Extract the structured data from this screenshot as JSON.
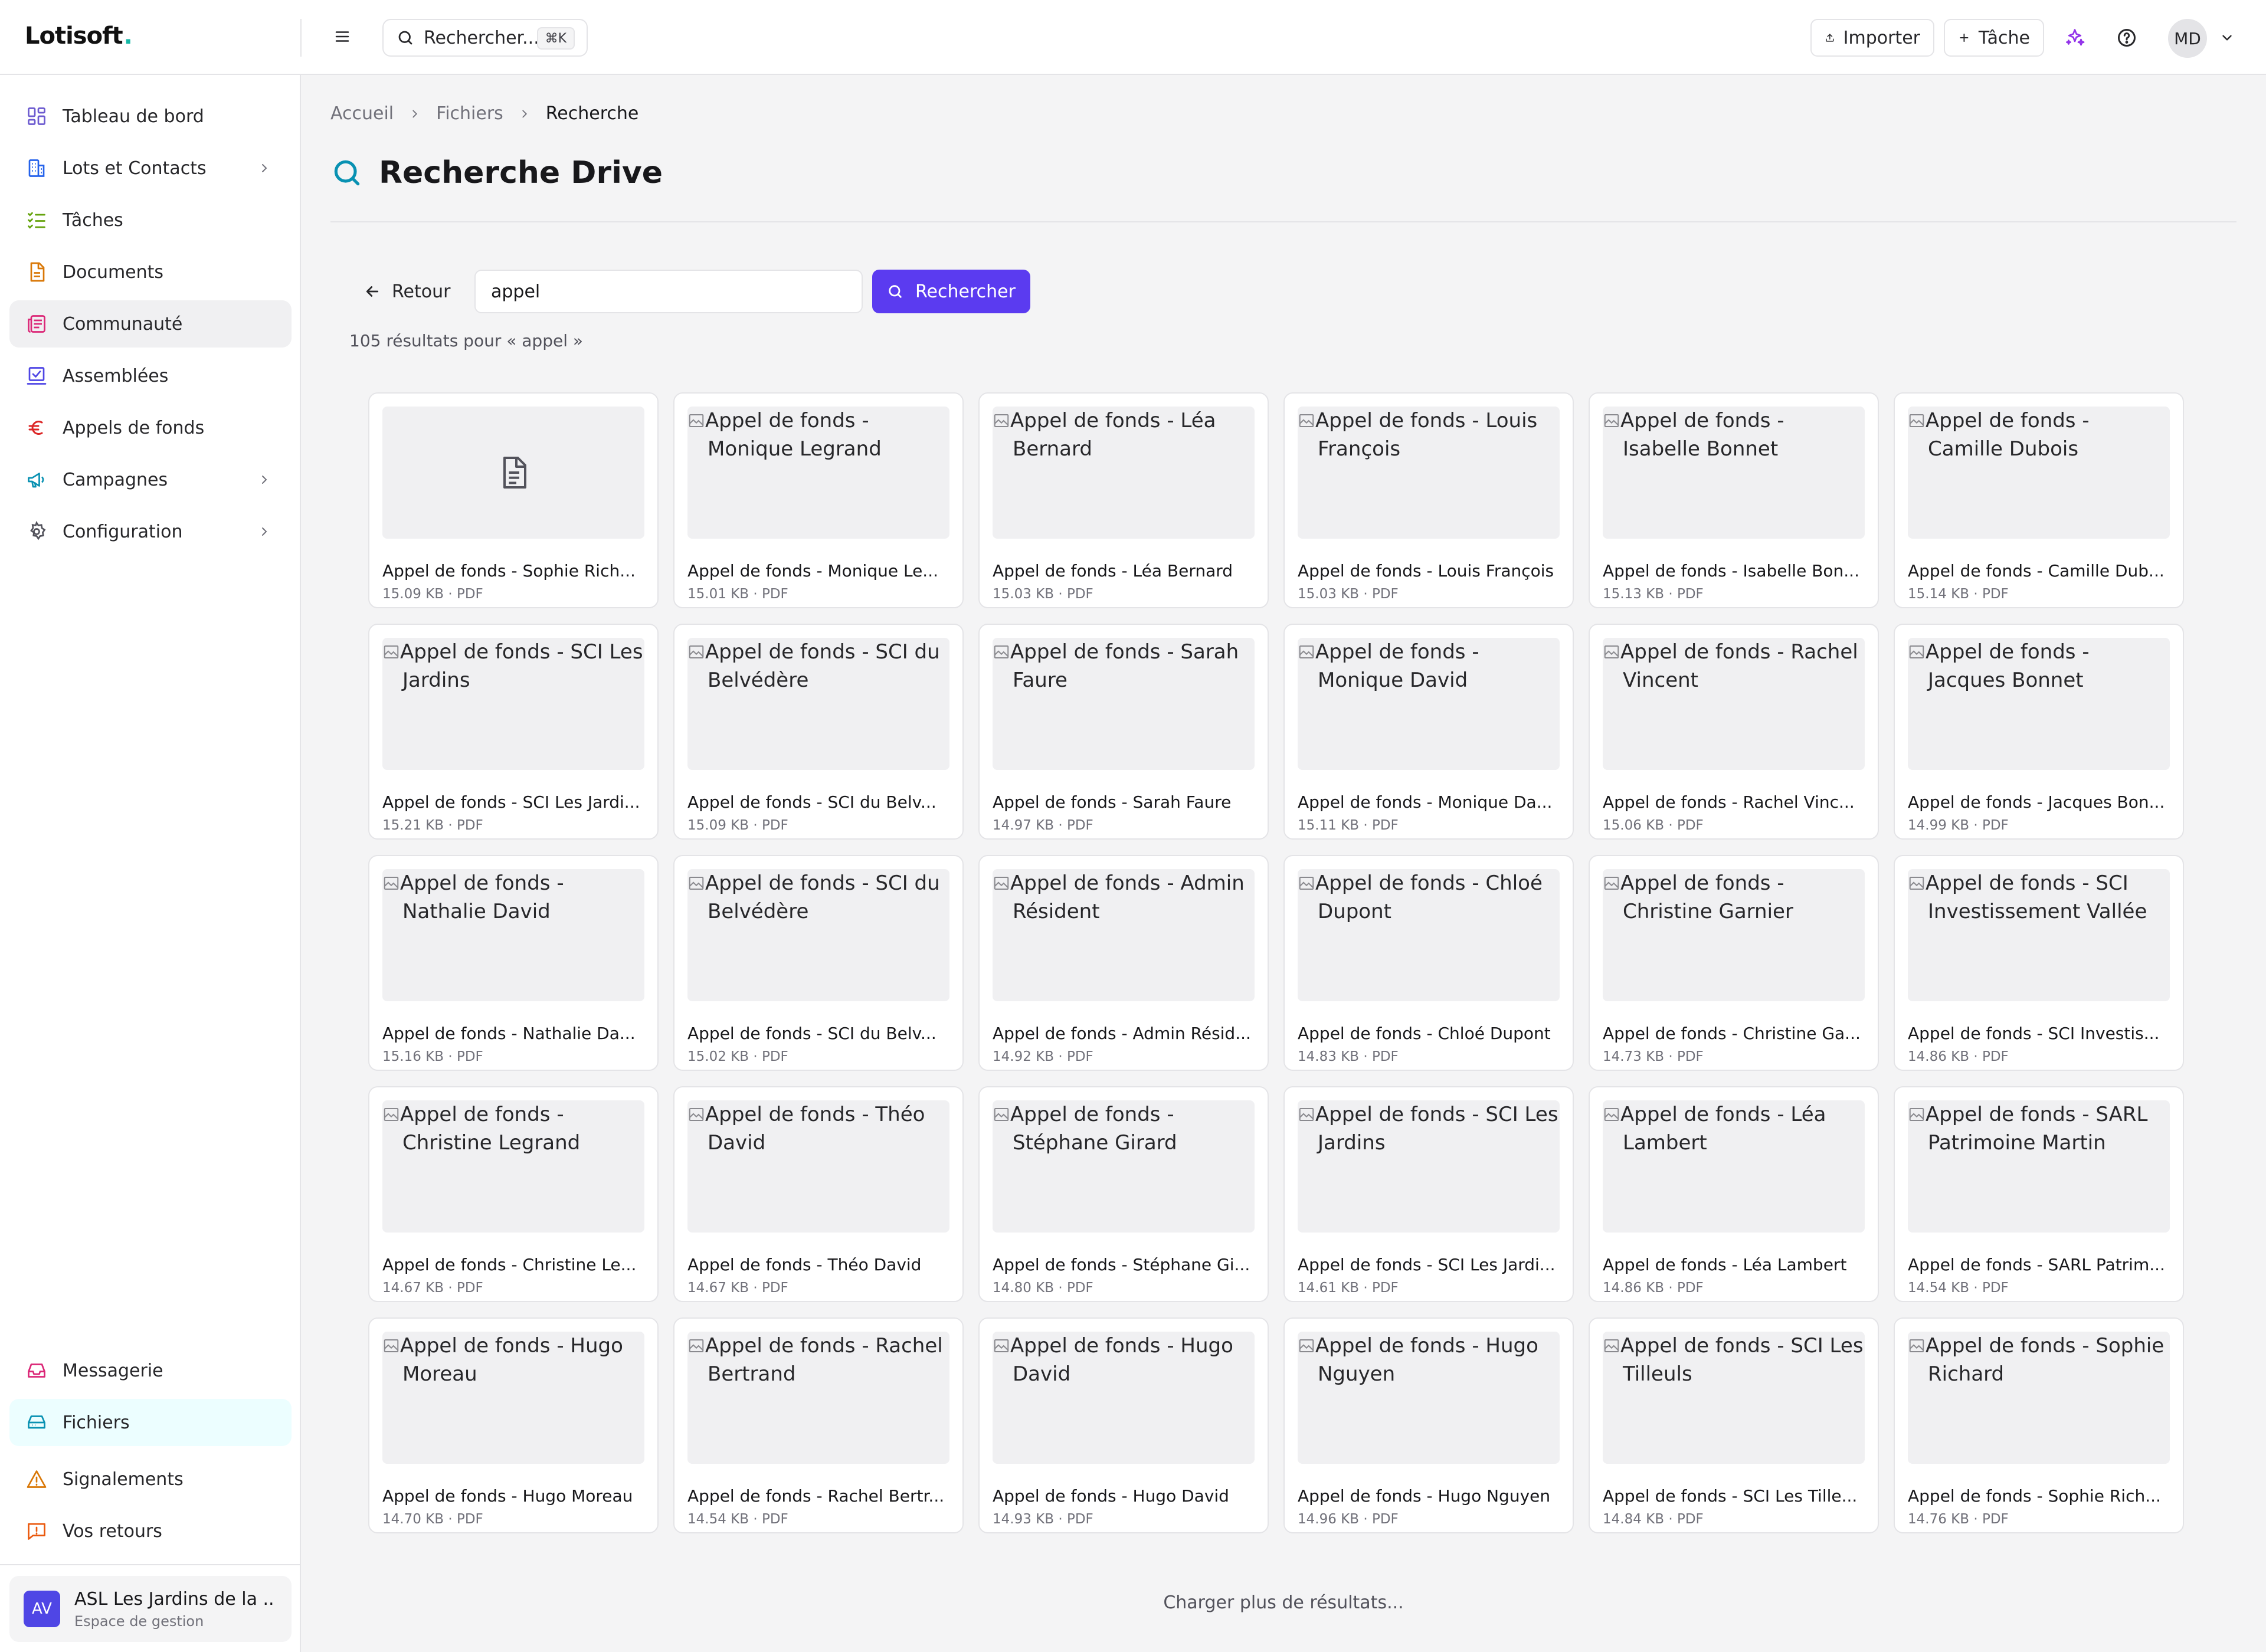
{
  "app": {
    "logo_text": "Lotisoft",
    "logo_dot": ".",
    "accent": "#5b3bf0"
  },
  "topbar": {
    "search_placeholder": "Rechercher...",
    "search_shortcut": "⌘K",
    "import_label": "Importer",
    "task_label": "Tâche",
    "avatar_initials": "MD"
  },
  "sidebar": {
    "items": [
      {
        "label": "Tableau de bord",
        "icon": "dashboard-icon",
        "color": "#6d5bd0"
      },
      {
        "label": "Lots et Contacts",
        "icon": "building-icon",
        "color": "#2563eb",
        "expandable": true
      },
      {
        "label": "Tâches",
        "icon": "checklist-icon",
        "color": "#65a30d"
      },
      {
        "label": "Documents",
        "icon": "document-icon",
        "color": "#d97706"
      },
      {
        "label": "Communauté",
        "icon": "newspaper-icon",
        "color": "#db2777",
        "active": true
      },
      {
        "label": "Assemblées",
        "icon": "vote-icon",
        "color": "#4f46e5"
      },
      {
        "label": "Appels de fonds",
        "icon": "euro-icon",
        "color": "#dc2626"
      },
      {
        "label": "Campagnes",
        "icon": "megaphone-icon",
        "color": "#0891b2",
        "expandable": true
      },
      {
        "label": "Configuration",
        "icon": "gear-icon",
        "color": "#52525b",
        "expandable": true
      }
    ],
    "bottom_items": [
      {
        "label": "Messagerie",
        "icon": "inbox-icon",
        "color": "#db2777"
      },
      {
        "label": "Fichiers",
        "icon": "drive-icon",
        "color": "#0891b2",
        "active": true
      },
      {
        "label": "Signalements",
        "icon": "warning-icon",
        "color": "#d97706"
      },
      {
        "label": "Vos retours",
        "icon": "feedback-icon",
        "color": "#ea580c"
      }
    ],
    "org": {
      "initials": "AV",
      "name": "ASL Les Jardins de la ...",
      "subtitle": "Espace de gestion"
    }
  },
  "breadcrumb": {
    "home": "Accueil",
    "files": "Fichiers",
    "current": "Recherche"
  },
  "page": {
    "title": "Recherche Drive"
  },
  "search": {
    "back_label": "Retour",
    "query": "appel",
    "button_label": "Rechercher",
    "results_text": "105 résultats pour « appel »"
  },
  "results": [
    {
      "alt": "",
      "name": "Appel de fonds - Sophie Rich...",
      "meta": "15.09 KB · PDF",
      "placeholder": true
    },
    {
      "alt": "Appel de fonds - Monique Legrand",
      "name": "Appel de fonds - Monique Le...",
      "meta": "15.01 KB · PDF"
    },
    {
      "alt": "Appel de fonds - Léa Bernard",
      "name": "Appel de fonds - Léa Bernard",
      "meta": "15.03 KB · PDF"
    },
    {
      "alt": "Appel de fonds - Louis François",
      "name": "Appel de fonds - Louis François",
      "meta": "15.03 KB · PDF"
    },
    {
      "alt": "Appel de fonds - Isabelle Bonnet",
      "name": "Appel de fonds - Isabelle Bon...",
      "meta": "15.13 KB · PDF"
    },
    {
      "alt": "Appel de fonds - Camille Dubois",
      "name": "Appel de fonds - Camille Dub...",
      "meta": "15.14 KB · PDF"
    },
    {
      "alt": "Appel de fonds - SCI Les Jardins",
      "name": "Appel de fonds - SCI Les Jardi...",
      "meta": "15.21 KB · PDF"
    },
    {
      "alt": "Appel de fonds - SCI du Belvédère",
      "name": "Appel de fonds - SCI du Belv...",
      "meta": "15.09 KB · PDF"
    },
    {
      "alt": "Appel de fonds - Sarah Faure",
      "name": "Appel de fonds - Sarah Faure",
      "meta": "14.97 KB · PDF"
    },
    {
      "alt": "Appel de fonds - Monique David",
      "name": "Appel de fonds - Monique Da...",
      "meta": "15.11 KB · PDF"
    },
    {
      "alt": "Appel de fonds - Rachel Vincent",
      "name": "Appel de fonds - Rachel Vinc...",
      "meta": "15.06 KB · PDF"
    },
    {
      "alt": "Appel de fonds - Jacques Bonnet",
      "name": "Appel de fonds - Jacques Bon...",
      "meta": "14.99 KB · PDF"
    },
    {
      "alt": "Appel de fonds - Nathalie David",
      "name": "Appel de fonds - Nathalie Da...",
      "meta": "15.16 KB · PDF"
    },
    {
      "alt": "Appel de fonds - SCI du Belvédère",
      "name": "Appel de fonds - SCI du Belv...",
      "meta": "15.02 KB · PDF"
    },
    {
      "alt": "Appel de fonds - Admin Résident",
      "name": "Appel de fonds - Admin Résid...",
      "meta": "14.92 KB · PDF"
    },
    {
      "alt": "Appel de fonds - Chloé Dupont",
      "name": "Appel de fonds - Chloé Dupont",
      "meta": "14.83 KB · PDF"
    },
    {
      "alt": "Appel de fonds - Christine Garnier",
      "name": "Appel de fonds - Christine Ga...",
      "meta": "14.73 KB · PDF"
    },
    {
      "alt": "Appel de fonds - SCI Investissement Vallée",
      "name": "Appel de fonds - SCI Investis...",
      "meta": "14.86 KB · PDF"
    },
    {
      "alt": "Appel de fonds - Christine Legrand",
      "name": "Appel de fonds - Christine Le...",
      "meta": "14.67 KB · PDF"
    },
    {
      "alt": "Appel de fonds - Théo David",
      "name": "Appel de fonds - Théo David",
      "meta": "14.67 KB · PDF"
    },
    {
      "alt": "Appel de fonds - Stéphane Girard",
      "name": "Appel de fonds - Stéphane Gi...",
      "meta": "14.80 KB · PDF"
    },
    {
      "alt": "Appel de fonds - SCI Les Jardins",
      "name": "Appel de fonds - SCI Les Jardi...",
      "meta": "14.61 KB · PDF"
    },
    {
      "alt": "Appel de fonds - Léa Lambert",
      "name": "Appel de fonds - Léa Lambert",
      "meta": "14.86 KB · PDF"
    },
    {
      "alt": "Appel de fonds - SARL Patrimoine Martin",
      "name": "Appel de fonds - SARL Patrim...",
      "meta": "14.54 KB · PDF"
    },
    {
      "alt": "Appel de fonds - Hugo Moreau",
      "name": "Appel de fonds - Hugo Moreau",
      "meta": "14.70 KB · PDF"
    },
    {
      "alt": "Appel de fonds - Rachel Bertrand",
      "name": "Appel de fonds - Rachel Bertr...",
      "meta": "14.54 KB · PDF"
    },
    {
      "alt": "Appel de fonds - Hugo David",
      "name": "Appel de fonds - Hugo David",
      "meta": "14.93 KB · PDF"
    },
    {
      "alt": "Appel de fonds - Hugo Nguyen",
      "name": "Appel de fonds - Hugo Nguyen",
      "meta": "14.96 KB · PDF"
    },
    {
      "alt": "Appel de fonds - SCI Les Tilleuls",
      "name": "Appel de fonds - SCI Les Tille...",
      "meta": "14.84 KB · PDF"
    },
    {
      "alt": "Appel de fonds - Sophie Richard",
      "name": "Appel de fonds - Sophie Rich...",
      "meta": "14.76 KB · PDF"
    }
  ],
  "load_more_label": "Charger plus de résultats..."
}
